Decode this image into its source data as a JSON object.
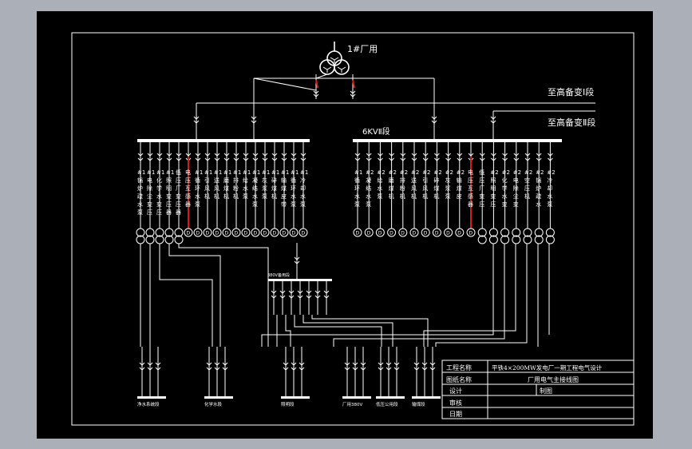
{
  "drawing": {
    "transformer_label": "1#厂用",
    "feed1_label": "至高备变Ⅰ段",
    "feed2_label": "至高备变Ⅱ段",
    "bus2_label": "6KVⅡ段",
    "aux_bus_label": "380V备用段",
    "left_feeders": [
      [
        "#1",
        "锅",
        "炉",
        "疏",
        "水",
        "泵"
      ],
      [
        "#1",
        "电",
        "除",
        "尘",
        "变",
        "压"
      ],
      [
        "#1",
        "化",
        "学",
        "水",
        "变",
        "压"
      ],
      [
        "#1",
        "照",
        "明",
        "变",
        "压",
        "器"
      ],
      [
        "低",
        "压",
        "厂",
        "变",
        "压",
        "器"
      ],
      [
        "电",
        "压",
        "互",
        "感",
        "器"
      ],
      [
        "#1",
        "循",
        "环",
        "水",
        "泵"
      ],
      [
        "#1",
        "引",
        "风",
        "机"
      ],
      [
        "#1",
        "送",
        "风",
        "机"
      ],
      [
        "#1",
        "磨",
        "煤",
        "机"
      ],
      [
        "#1",
        "排",
        "粉",
        "机"
      ],
      [
        "#1",
        "给",
        "水",
        "泵"
      ],
      [
        "#1",
        "凝",
        "结",
        "水",
        "泵"
      ],
      [
        "#1",
        "灰",
        "浆",
        "泵"
      ],
      [
        "#1",
        "碎",
        "煤",
        "机"
      ],
      [
        "#1",
        "输",
        "煤",
        "皮",
        "带"
      ],
      [
        "#1",
        "循",
        "环",
        "水",
        "泵"
      ],
      [
        "#1",
        "冷",
        "却",
        "水",
        "泵"
      ]
    ],
    "right_feeders": [
      [
        "#1",
        "循",
        "环",
        "水",
        "泵"
      ],
      [
        "#2",
        "凝",
        "结",
        "水",
        "泵"
      ],
      [
        "#2",
        "给",
        "水",
        "泵"
      ],
      [
        "#2",
        "磨",
        "煤",
        "机"
      ],
      [
        "#2",
        "排",
        "粉",
        "机"
      ],
      [
        "#2",
        "送",
        "风",
        "机"
      ],
      [
        "#2",
        "引",
        "风",
        "机"
      ],
      [
        "#2",
        "碎",
        "煤",
        "机"
      ],
      [
        "#2",
        "灰",
        "浆",
        "泵"
      ],
      [
        "#2",
        "输",
        "煤",
        "皮"
      ],
      [
        "电",
        "压",
        "互",
        "感",
        "器"
      ],
      [
        "低",
        "压",
        "厂",
        "变",
        "压"
      ],
      [
        "#2",
        "照",
        "明",
        "变",
        "压"
      ],
      [
        "#2",
        "化",
        "学",
        "水",
        "变"
      ],
      [
        "#2",
        "电",
        "除",
        "尘",
        "变"
      ],
      [
        "#2",
        "空",
        "压",
        "机"
      ],
      [
        "#2",
        "锅",
        "炉",
        "疏",
        "水"
      ],
      [
        "#2",
        "冷",
        "却",
        "水",
        "泵"
      ]
    ],
    "bottom_buses": [
      "净水系统段",
      "化学水段",
      "照明段",
      "厂用380V",
      "低压公用段",
      "输煤段"
    ]
  },
  "title_block": {
    "r1_label": "工程名称",
    "r1_value": "平铁4×200MW发电厂一期工程电气设计",
    "r2_label": "图纸名称",
    "r2_value": "厂用电气主接线图",
    "r3_label": "设计",
    "r3_value": "制图",
    "r4_label": "审核",
    "r5_label": "日期"
  },
  "colors": {
    "background": "#abb0b8",
    "sheet": "#000000",
    "line": "#ffffff",
    "highlight": "#d41c1c"
  }
}
